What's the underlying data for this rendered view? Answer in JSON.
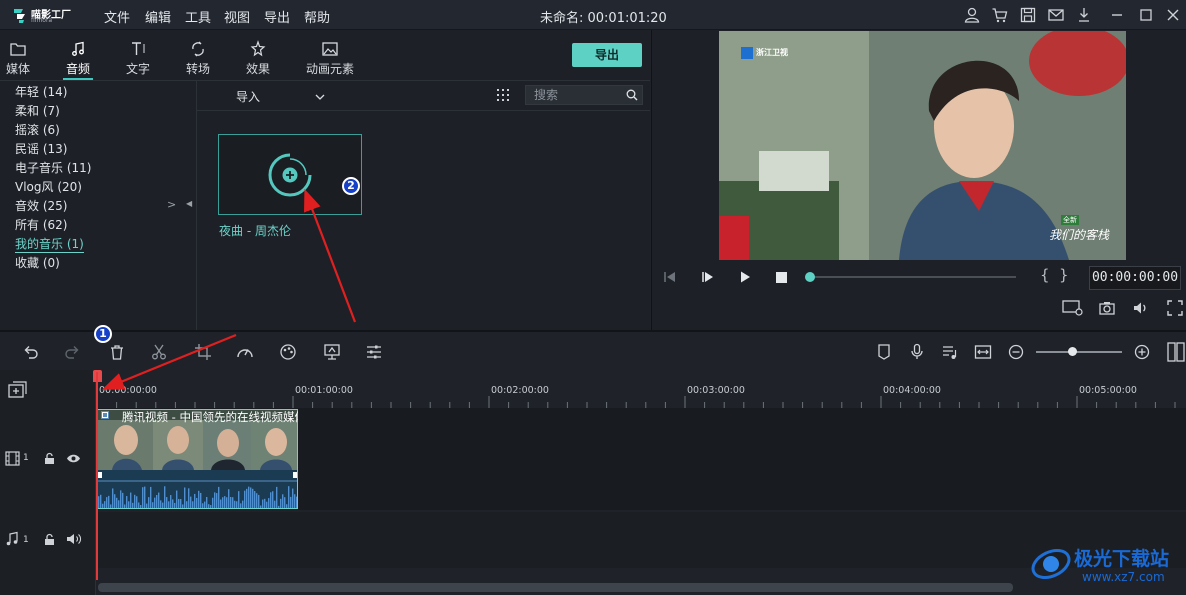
{
  "app": {
    "name": "喵影工厂",
    "sub": "filmora",
    "doc_title": "未命名: 00:01:01:20"
  },
  "menu": [
    "文件",
    "编辑",
    "工具",
    "视图",
    "导出",
    "帮助"
  ],
  "tabs": [
    {
      "label": "媒体",
      "icon": "folder-icon"
    },
    {
      "label": "音频",
      "icon": "music-note-icon"
    },
    {
      "label": "文字",
      "icon": "text-icon"
    },
    {
      "label": "转场",
      "icon": "transition-icon"
    },
    {
      "label": "效果",
      "icon": "effects-icon"
    },
    {
      "label": "动画元素",
      "icon": "image-icon"
    }
  ],
  "export_label": "导出",
  "categories": [
    "年轻 (14)",
    "柔和 (7)",
    "摇滚 (6)",
    "民谣 (13)",
    "电子音乐 (11)",
    "Vlog风 (20)",
    "音效 (25)",
    "所有 (62)",
    "我的音乐 (1)",
    "收藏 (0)"
  ],
  "import_label": "导入",
  "search_placeholder": "搜索",
  "audio_item": {
    "title": "夜曲 - 周杰伦"
  },
  "preview": {
    "timecode": "00:00:00:00",
    "channel_logo": "浙江卫视",
    "show_text": "我们的客栈",
    "show_badge": "全新"
  },
  "ruler": [
    "00:00:00:00",
    "00:01:00:00",
    "00:02:00:00",
    "00:03:00:00",
    "00:04:00:00",
    "00:05:00:00"
  ],
  "clip_title": "腾讯视频 - 中国领先的在线视频媒体平台",
  "track_numbers": [
    "1",
    "1"
  ],
  "annotations": [
    "1",
    "2"
  ],
  "watermark": {
    "name": "极光下载站",
    "url": "www.xz7.com"
  },
  "colors": {
    "accent": "#5ed1c5",
    "playhead": "#e23a3a",
    "arrow": "#e02020",
    "badge": "#1640c8"
  }
}
